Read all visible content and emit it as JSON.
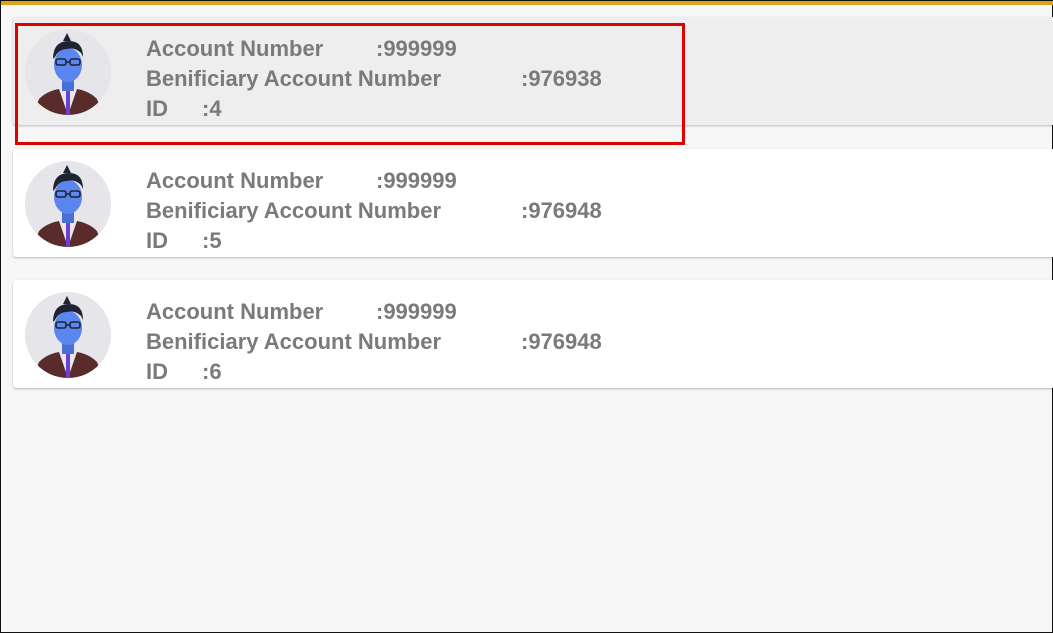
{
  "accounts": [
    {
      "account_label": "Account Number",
      "account_value": ":999999",
      "beneficiary_label": "Benificiary Account Number",
      "beneficiary_value": ":976938",
      "id_label": "ID",
      "id_value": ":4",
      "avatar_icon": "user-avatar-icon",
      "selected": true
    },
    {
      "account_label": "Account Number",
      "account_value": ":999999",
      "beneficiary_label": "Benificiary Account Number",
      "beneficiary_value": ":976948",
      "id_label": "ID",
      "id_value": ":5",
      "avatar_icon": "user-avatar-icon",
      "selected": false
    },
    {
      "account_label": "Account Number",
      "account_value": ":999999",
      "beneficiary_label": "Benificiary Account Number",
      "beneficiary_value": ":976948",
      "id_label": "ID",
      "id_value": ":6",
      "avatar_icon": "user-avatar-icon",
      "selected": false
    }
  ],
  "colors": {
    "top_bar": "#d9a21b",
    "highlight_border": "#e00000",
    "text": "#7a7a7a"
  }
}
